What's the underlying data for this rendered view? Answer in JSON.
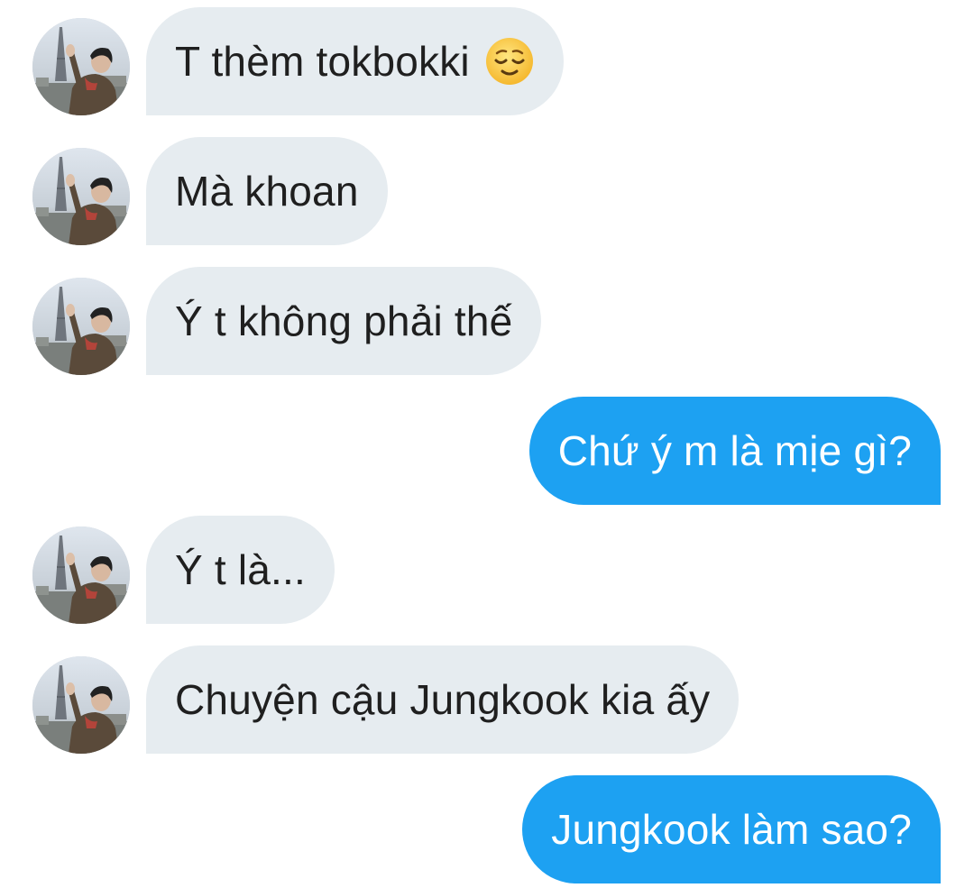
{
  "messages": [
    {
      "direction": "incoming",
      "text": "T thèm tokbokki",
      "emoji": "relieved-face-icon"
    },
    {
      "direction": "incoming",
      "text": "Mà khoan"
    },
    {
      "direction": "incoming",
      "text": "Ý t không phải thế"
    },
    {
      "direction": "outgoing",
      "text": "Chứ ý m là mịe gì?"
    },
    {
      "direction": "incoming",
      "text": "Ý t là..."
    },
    {
      "direction": "incoming",
      "text": "Chuyện cậu Jungkook kia ấy"
    },
    {
      "direction": "outgoing",
      "text": "Jungkook làm sao?"
    }
  ],
  "colors": {
    "incoming_bubble": "#e6ecf0",
    "incoming_text": "#1f1f1f",
    "outgoing_bubble": "#1da1f2",
    "outgoing_text": "#ffffff",
    "background": "#ffffff"
  }
}
